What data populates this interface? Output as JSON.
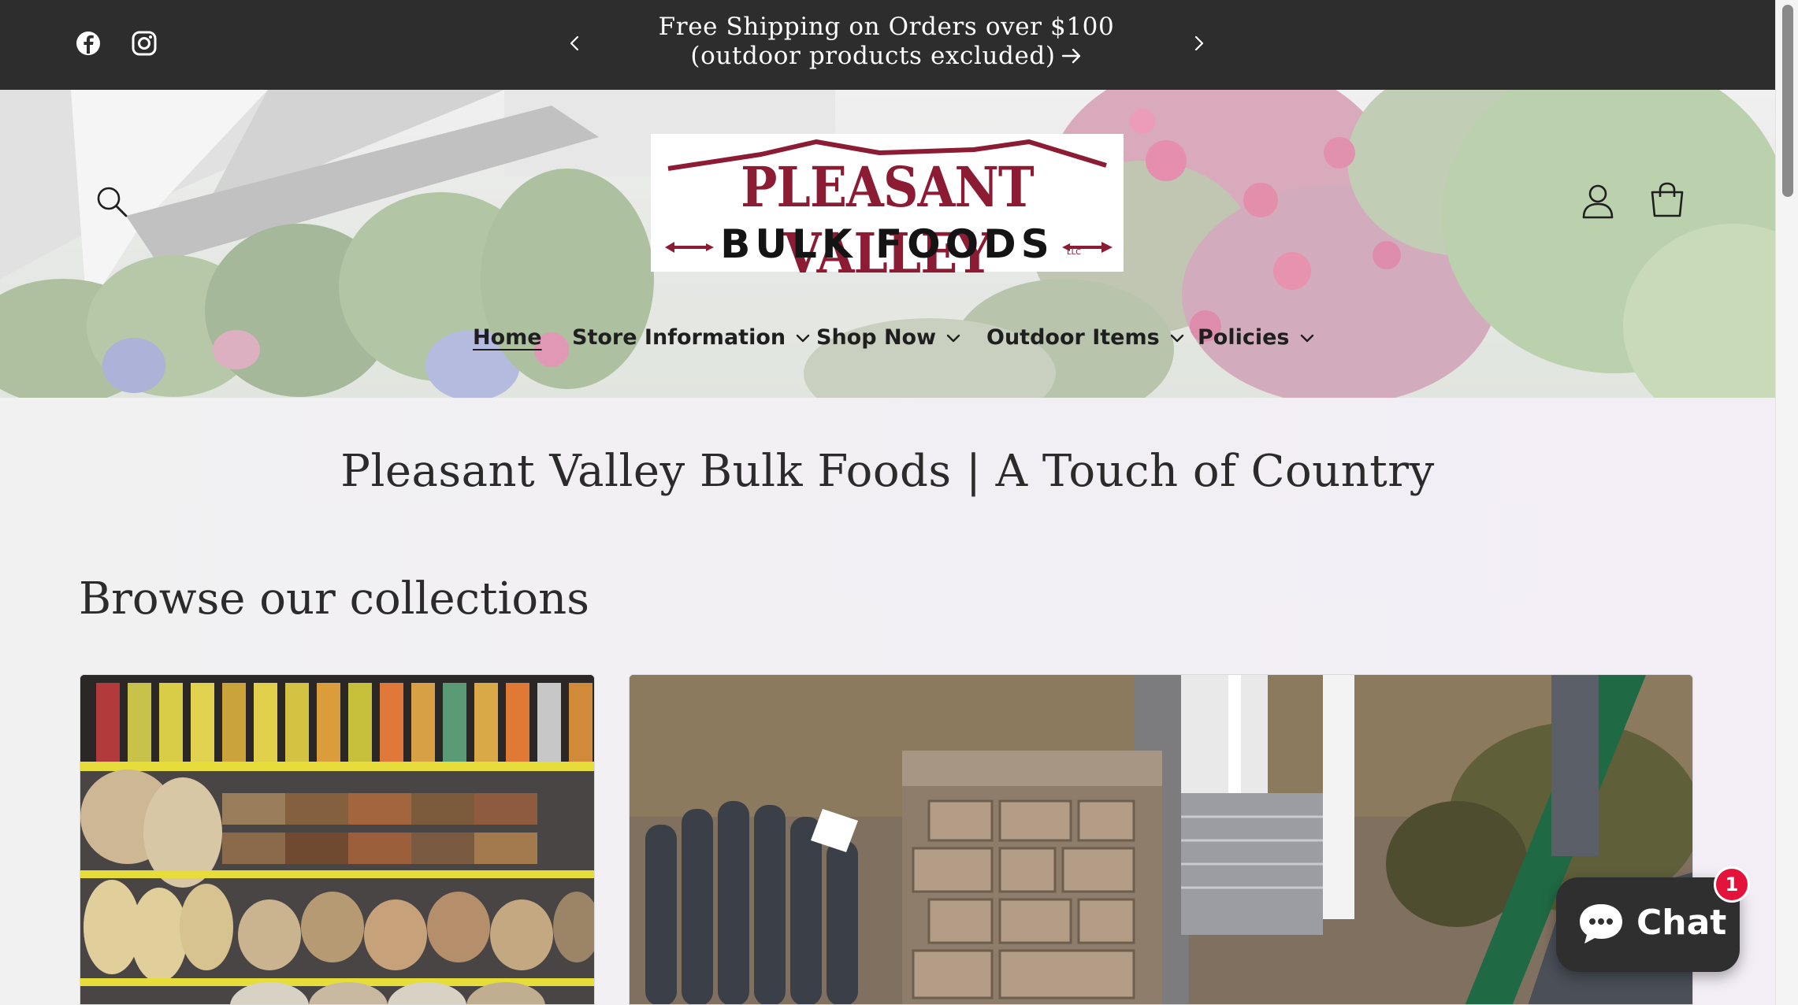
{
  "announcement": {
    "message": "Free Shipping on Orders over $100 (outdoor products excluded)",
    "social_icons": [
      "facebook-icon",
      "instagram-icon"
    ]
  },
  "header": {
    "logo": {
      "line1": "PLEASANT VALLEY",
      "line2": "BULK FOODS",
      "suffix": "LLC"
    },
    "nav": [
      {
        "label": "Home",
        "active": true,
        "has_dropdown": false
      },
      {
        "label": "Store Information",
        "active": false,
        "has_dropdown": true
      },
      {
        "label": "Shop Now",
        "active": false,
        "has_dropdown": true
      },
      {
        "label": "Outdoor Items",
        "active": false,
        "has_dropdown": true
      },
      {
        "label": "Policies",
        "active": false,
        "has_dropdown": true
      }
    ],
    "icons": [
      "search-icon",
      "account-icon",
      "cart-icon"
    ]
  },
  "main": {
    "page_title": "Pleasant Valley Bulk Foods | A Touch of Country",
    "collections_heading": "Browse our collections"
  },
  "chat": {
    "label": "Chat",
    "badge_count": "1"
  },
  "colors": {
    "announcement_bg": "#2d2d2d",
    "brand_red": "#8c1c34",
    "chat_bg": "#2f2f2f",
    "badge_red": "#e3133b"
  }
}
